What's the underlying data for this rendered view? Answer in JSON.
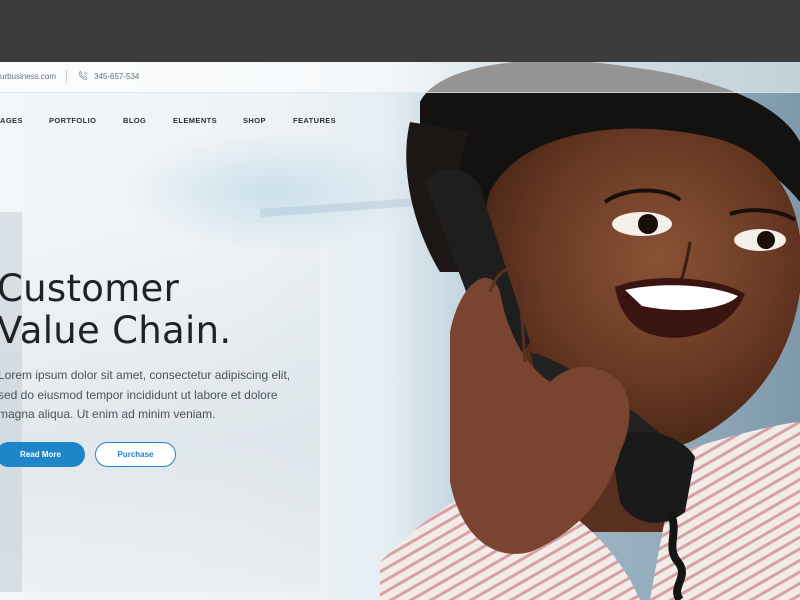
{
  "topbar": {
    "email": "urbusiness.com",
    "phone": "345-657-534"
  },
  "nav": {
    "items": [
      "AGES",
      "PORTFOLIO",
      "BLOG",
      "ELEMENTS",
      "SHOP",
      "FEATURES"
    ]
  },
  "hero": {
    "title_line1": "Customer",
    "title_line2": "Value Chain.",
    "body_line1": "Lorem ipsum dolor sit amet, consectetur adipiscing elit,",
    "body_line2": "sed do eiusmod tempor incididunt ut labore et dolore",
    "body_line3": "magna aliqua. Ut enim ad minim veniam.",
    "primary_button": "Read More",
    "secondary_button": "Purchase"
  },
  "colors": {
    "accent": "#1e86c8",
    "dark_strip": "#3d3c3c",
    "heading": "#1f2327"
  },
  "icons": [
    "phone-icon"
  ]
}
